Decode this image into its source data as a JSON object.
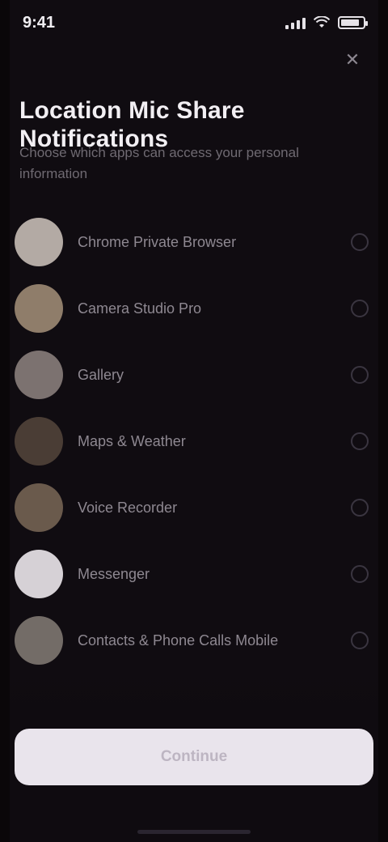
{
  "status_bar": {
    "time": "9:41"
  },
  "title": "Location Mic Share Notifications",
  "subtitle": "Choose which apps can access your personal information",
  "list": {
    "items": [
      {
        "label": "Chrome Private Browser",
        "avatar_color": "#b3aaa4"
      },
      {
        "label": "Camera Studio Pro",
        "avatar_color": "#8f7d6a"
      },
      {
        "label": "Gallery",
        "avatar_color": "#7c7270"
      },
      {
        "label": "Maps & Weather",
        "avatar_color": "#4a3d35"
      },
      {
        "label": "Voice Recorder",
        "avatar_color": "#6a5a4c"
      },
      {
        "label": "Messenger",
        "avatar_color": "#d6d1d6"
      },
      {
        "label": "Contacts & Phone Calls Mobile",
        "avatar_color": "#736c67"
      }
    ]
  },
  "primary_button": {
    "label": "Continue"
  },
  "icons": {
    "close": "close-icon",
    "signal": "signal-icon",
    "wifi": "wifi-icon",
    "battery": "battery-icon"
  },
  "colors": {
    "background": "#100c11",
    "button": "#e9e4ec",
    "title": "#f2eff3"
  }
}
